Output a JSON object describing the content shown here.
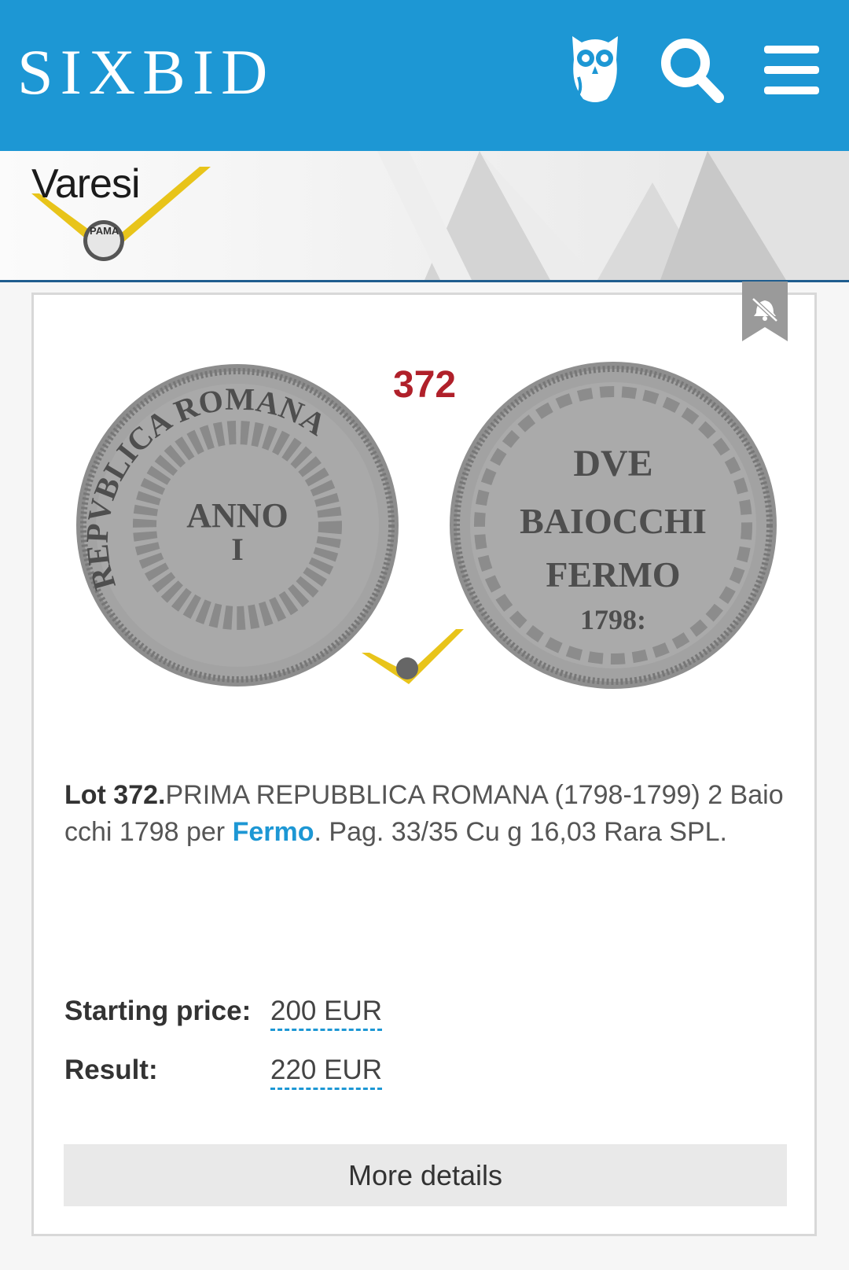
{
  "header": {
    "brand": "SIXBID",
    "icons": [
      "owl-icon",
      "search-icon",
      "menu-icon"
    ]
  },
  "banner": {
    "auctioneer": "Varesi",
    "badge": "PAMA"
  },
  "lot": {
    "image_number": "372",
    "coin_obverse_legend": "REPVBLICA ROMANA",
    "coin_obverse_center": [
      "ANNO",
      "I"
    ],
    "coin_reverse_lines": [
      "DVE",
      "BAIOCCHI",
      "FERMO",
      "1798:"
    ],
    "lot_label": "Lot 372.",
    "title_part1": "PRIMA REPUBBLICA ROMANA (1798-1799) 2 Baiocchi 1798 per ",
    "location": "Fermo",
    "title_part2": ". Pag. 33/35 Cu g 16,03 Rara SPL."
  },
  "prices": {
    "starting_label": "Starting price:",
    "starting_value": "200 EUR",
    "result_label": "Result:",
    "result_value": "220 EUR"
  },
  "actions": {
    "more_details": "More details"
  },
  "colors": {
    "header_blue": "#1d97d4",
    "lot_red": "#b0202a",
    "link_blue": "#1d97d4"
  }
}
